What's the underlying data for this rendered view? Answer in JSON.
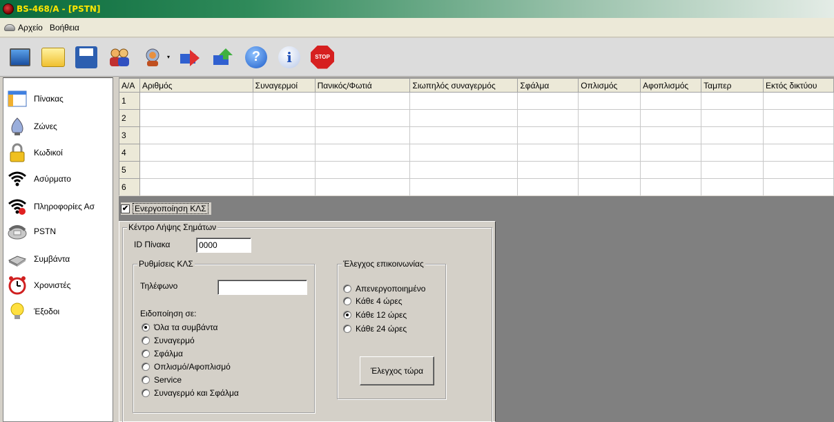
{
  "window": {
    "title": "BS-468/A - [PSTN]"
  },
  "menu": {
    "items": [
      "Αρχείο",
      "Βοήθεια"
    ]
  },
  "toolbar": {
    "buttons": [
      "monitor-icon",
      "folder-icon",
      "save-icon",
      "users-icon",
      "user-dropdown-icon",
      "download-icon",
      "upload-icon",
      "help-icon",
      "info-icon",
      "stop-icon"
    ],
    "help_glyph": "?",
    "info_glyph": "i",
    "stop_label": "STOP"
  },
  "sidebar": {
    "items": [
      {
        "label": "Πίνακας",
        "icon": "panel-icon"
      },
      {
        "label": "Ζώνες",
        "icon": "zones-icon"
      },
      {
        "label": "Κωδικοί",
        "icon": "lock-icon"
      },
      {
        "label": "Ασύρματο",
        "icon": "wireless-icon"
      },
      {
        "label": "Πληροφορίες Ασ",
        "icon": "wireless-info-icon"
      },
      {
        "label": "PSTN",
        "icon": "phone-icon"
      },
      {
        "label": "Συμβάντα",
        "icon": "events-icon"
      },
      {
        "label": "Χρονιστές",
        "icon": "alarm-clock-icon"
      },
      {
        "label": "Έξοδοι",
        "icon": "bulb-icon"
      }
    ],
    "selected": "PSTN"
  },
  "grid": {
    "columns": [
      "Α/Α",
      "Αριθμός",
      "Συναγερμοί",
      "Πανικός/Φωτιά",
      "Σιωπηλός συναγερμός",
      "Σφάλμα",
      "Οπλισμός",
      "Αφοπλισμός",
      "Ταμπερ",
      "Εκτός δικτύου"
    ],
    "rows": [
      "1",
      "2",
      "3",
      "4",
      "5",
      "6"
    ]
  },
  "enable_checkbox": {
    "label": "Ενεργοποίηση ΚΛΣ",
    "checked": true,
    "mark": "✔"
  },
  "receiver": {
    "group_title": "Κέντρο Λήψης Σημάτων",
    "panel_id_label": "ID Πίνακα",
    "panel_id_value": "0000",
    "settings": {
      "group_title": "Ρυθμίσεις ΚΛΣ",
      "phone_label": "Τηλέφωνο",
      "phone_value": "",
      "notify_label": "Ειδοποίηση σε:",
      "options": [
        "Όλα τα συμβάντα",
        "Συναγερμό",
        "Σφάλμα",
        "Οπλισμό/Αφοπλισμό",
        "Service",
        "Συναγερμό και Σφάλμα"
      ],
      "selected_index": 0
    },
    "comm_check": {
      "group_title": "Έλεγχος επικοινωνίας",
      "options": [
        "Απενεργοποιημένο",
        "Κάθε 4 ώρες",
        "Κάθε 12 ώρες",
        "Κάθε 24 ώρες"
      ],
      "selected_index": 2,
      "button_label": "Έλεγχος τώρα"
    }
  }
}
